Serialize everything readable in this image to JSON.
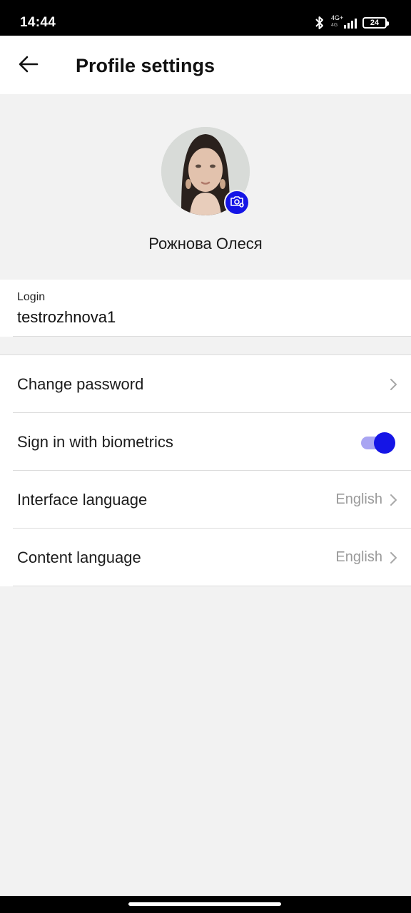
{
  "status_bar": {
    "time": "14:44",
    "network": "4G+",
    "network_sub": "4G",
    "battery": "24"
  },
  "header": {
    "title": "Profile settings",
    "back_icon": "arrow-left-icon"
  },
  "profile": {
    "name": "Рожнова Олеся",
    "camera_icon": "camera-add-icon"
  },
  "login": {
    "label": "Login",
    "value": "testrozhnova1"
  },
  "settings": {
    "change_password": {
      "label": "Change password"
    },
    "biometrics": {
      "label": "Sign in with biometrics",
      "enabled": true
    },
    "interface_language": {
      "label": "Interface language",
      "value": "English"
    },
    "content_language": {
      "label": "Content language",
      "value": "English"
    }
  },
  "colors": {
    "accent": "#1515e6",
    "toggle_track": "#a9a5f2",
    "background": "#f2f2f2",
    "secondary_text": "#9a9a9a"
  }
}
